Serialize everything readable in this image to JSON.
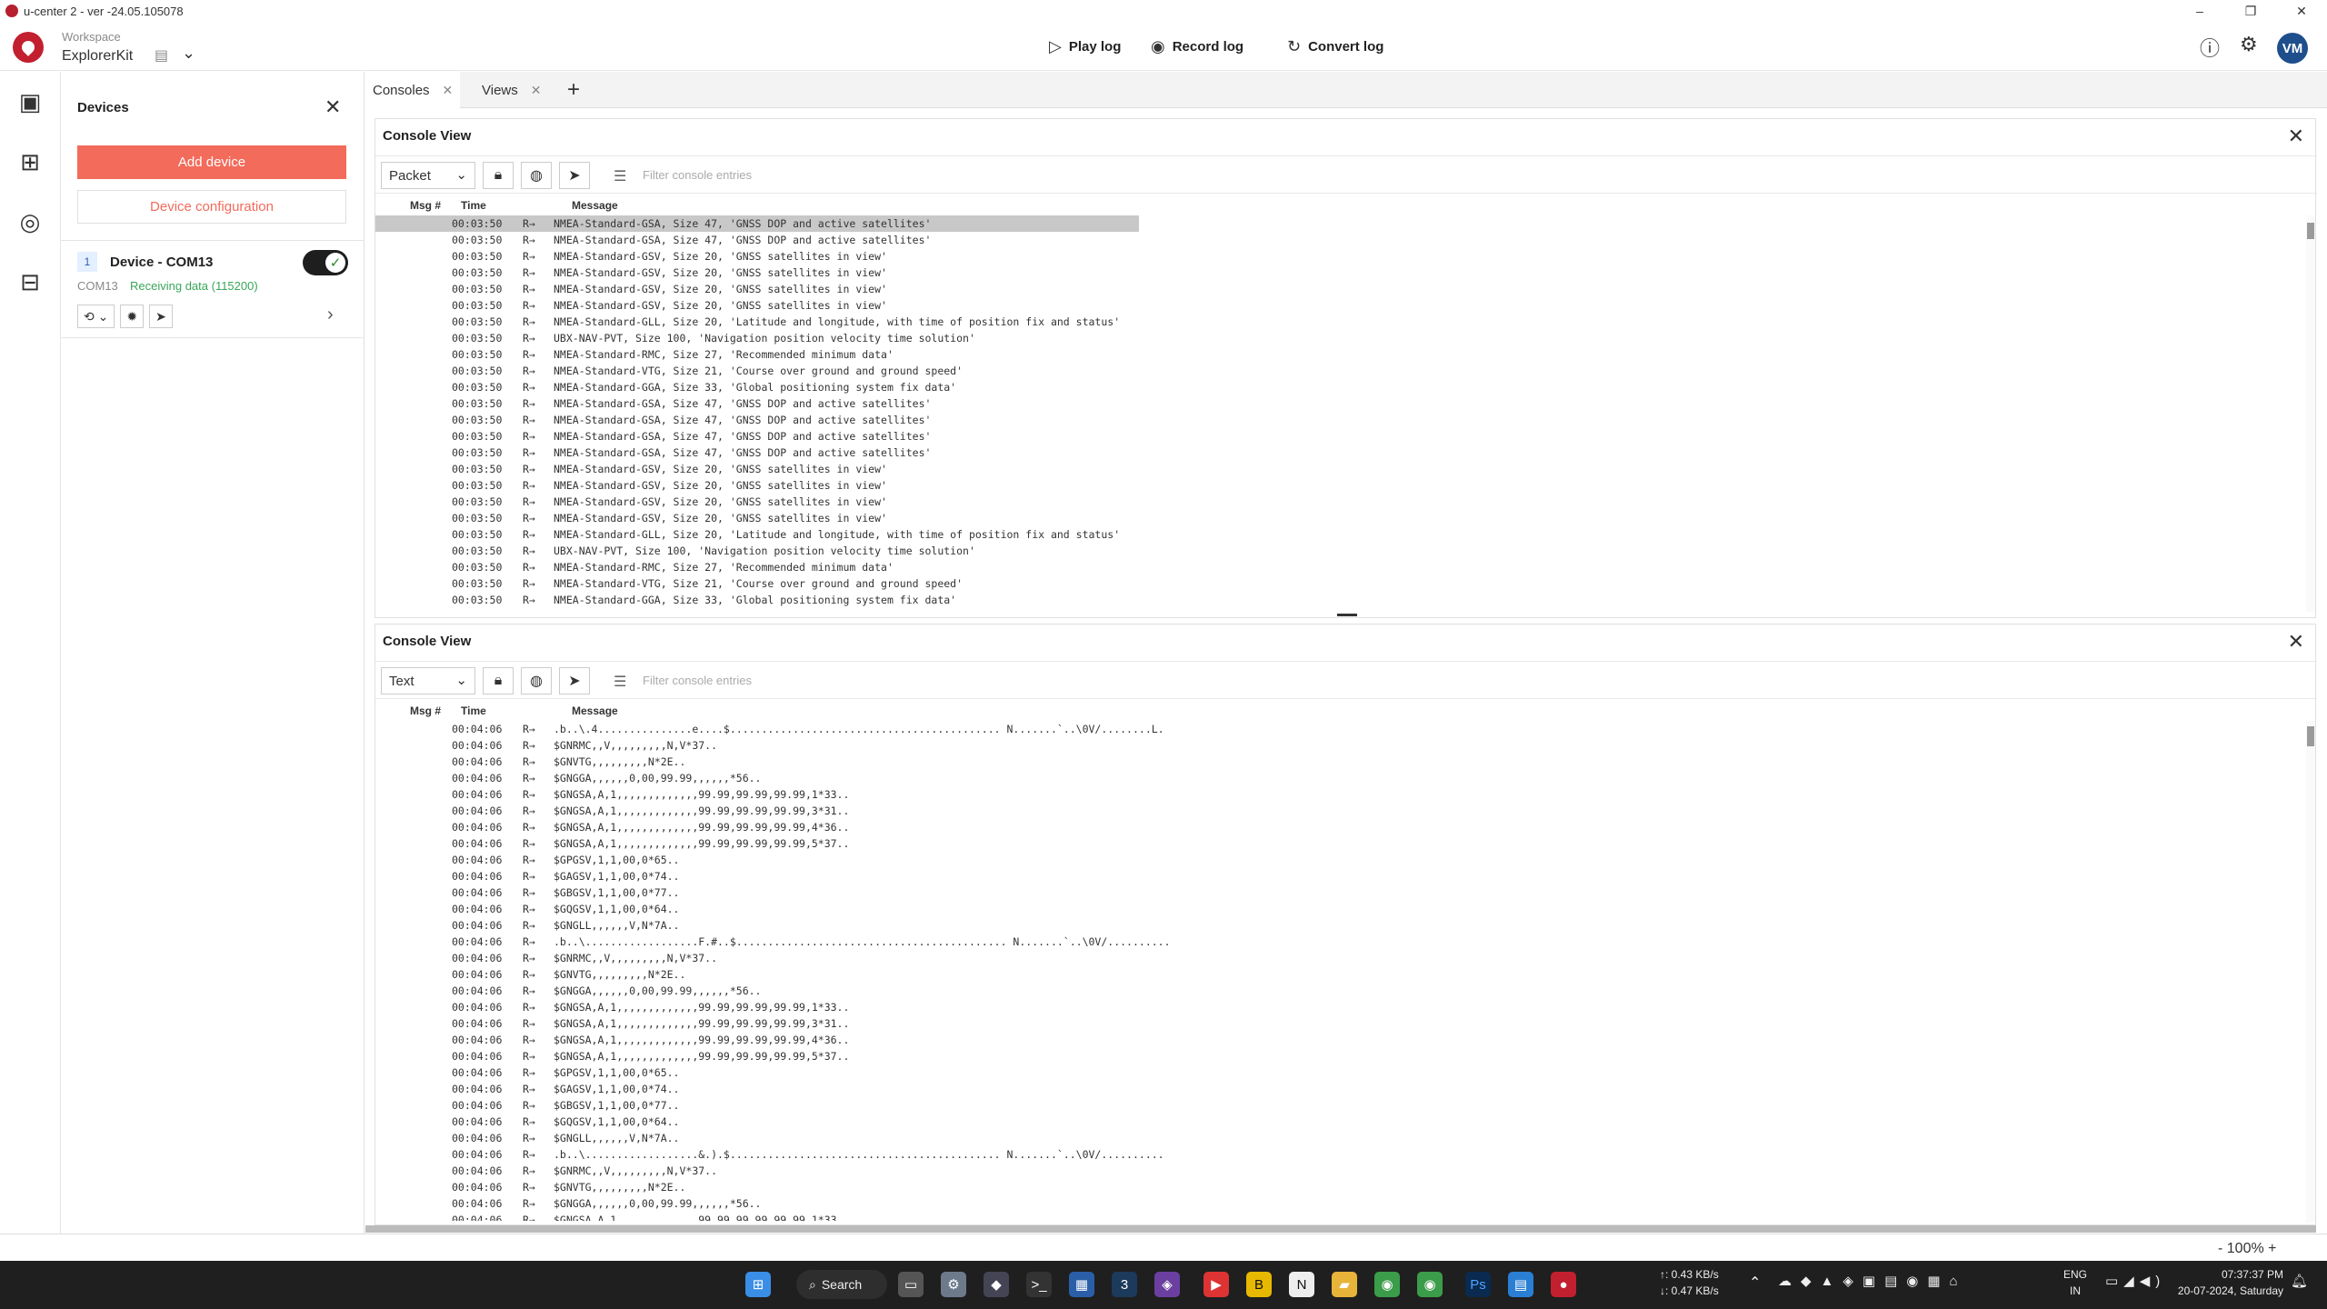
{
  "window": {
    "title": "u-center 2 - ver -24.05.105078",
    "controls": [
      "–",
      "❐",
      "✕"
    ]
  },
  "header": {
    "workspace_label": "Workspace",
    "workspace_name": "ExplorerKit",
    "play_log": "Play log",
    "record_log": "Record log",
    "convert_log": "Convert log",
    "user_initials": "VM"
  },
  "devices": {
    "title": "Devices",
    "add_device": "Add device",
    "device_configuration": "Device configuration",
    "item": {
      "index": "1",
      "name": "Device - COM13",
      "port": "COM13",
      "status": "Receiving data (115200)",
      "enabled": true
    }
  },
  "tabs": [
    {
      "label": "Consoles",
      "active": true
    },
    {
      "label": "Views",
      "active": false
    }
  ],
  "consoles": [
    {
      "title": "Console View",
      "mode": "Packet",
      "filter_placeholder": "Filter console entries",
      "columns": [
        "Msg #",
        "Time",
        "Message"
      ],
      "rows": [
        {
          "time": "00:03:50",
          "dir": "R→",
          "msg": "NMEA-Standard-GSA, Size 47, 'GNSS DOP and active satellites'",
          "selected": true
        },
        {
          "time": "00:03:50",
          "dir": "R→",
          "msg": "NMEA-Standard-GSA, Size 47, 'GNSS DOP and active satellites'"
        },
        {
          "time": "00:03:50",
          "dir": "R→",
          "msg": "NMEA-Standard-GSV, Size 20, 'GNSS satellites in view'"
        },
        {
          "time": "00:03:50",
          "dir": "R→",
          "msg": "NMEA-Standard-GSV, Size 20, 'GNSS satellites in view'"
        },
        {
          "time": "00:03:50",
          "dir": "R→",
          "msg": "NMEA-Standard-GSV, Size 20, 'GNSS satellites in view'"
        },
        {
          "time": "00:03:50",
          "dir": "R→",
          "msg": "NMEA-Standard-GSV, Size 20, 'GNSS satellites in view'"
        },
        {
          "time": "00:03:50",
          "dir": "R→",
          "msg": "NMEA-Standard-GLL, Size 20, 'Latitude and longitude, with time of position fix and status'"
        },
        {
          "time": "00:03:50",
          "dir": "R→",
          "msg": "UBX-NAV-PVT, Size 100, 'Navigation position velocity time solution'"
        },
        {
          "time": "00:03:50",
          "dir": "R→",
          "msg": "NMEA-Standard-RMC, Size 27, 'Recommended minimum data'"
        },
        {
          "time": "00:03:50",
          "dir": "R→",
          "msg": "NMEA-Standard-VTG, Size 21, 'Course over ground and ground speed'"
        },
        {
          "time": "00:03:50",
          "dir": "R→",
          "msg": "NMEA-Standard-GGA, Size 33, 'Global positioning system fix data'"
        },
        {
          "time": "00:03:50",
          "dir": "R→",
          "msg": "NMEA-Standard-GSA, Size 47, 'GNSS DOP and active satellites'"
        },
        {
          "time": "00:03:50",
          "dir": "R→",
          "msg": "NMEA-Standard-GSA, Size 47, 'GNSS DOP and active satellites'"
        },
        {
          "time": "00:03:50",
          "dir": "R→",
          "msg": "NMEA-Standard-GSA, Size 47, 'GNSS DOP and active satellites'"
        },
        {
          "time": "00:03:50",
          "dir": "R→",
          "msg": "NMEA-Standard-GSA, Size 47, 'GNSS DOP and active satellites'"
        },
        {
          "time": "00:03:50",
          "dir": "R→",
          "msg": "NMEA-Standard-GSV, Size 20, 'GNSS satellites in view'"
        },
        {
          "time": "00:03:50",
          "dir": "R→",
          "msg": "NMEA-Standard-GSV, Size 20, 'GNSS satellites in view'"
        },
        {
          "time": "00:03:50",
          "dir": "R→",
          "msg": "NMEA-Standard-GSV, Size 20, 'GNSS satellites in view'"
        },
        {
          "time": "00:03:50",
          "dir": "R→",
          "msg": "NMEA-Standard-GSV, Size 20, 'GNSS satellites in view'"
        },
        {
          "time": "00:03:50",
          "dir": "R→",
          "msg": "NMEA-Standard-GLL, Size 20, 'Latitude and longitude, with time of position fix and status'"
        },
        {
          "time": "00:03:50",
          "dir": "R→",
          "msg": "UBX-NAV-PVT, Size 100, 'Navigation position velocity time solution'"
        },
        {
          "time": "00:03:50",
          "dir": "R→",
          "msg": "NMEA-Standard-RMC, Size 27, 'Recommended minimum data'"
        },
        {
          "time": "00:03:50",
          "dir": "R→",
          "msg": "NMEA-Standard-VTG, Size 21, 'Course over ground and ground speed'"
        },
        {
          "time": "00:03:50",
          "dir": "R→",
          "msg": "NMEA-Standard-GGA, Size 33, 'Global positioning system fix data'"
        }
      ]
    },
    {
      "title": "Console View",
      "mode": "Text",
      "filter_placeholder": "Filter console entries",
      "columns": [
        "Msg #",
        "Time",
        "Message"
      ],
      "rows": [
        {
          "time": "00:04:06",
          "dir": "R→",
          "msg": ".b..\\.4...............e....$........................................... N.......`..\\0V/........L."
        },
        {
          "time": "00:04:06",
          "dir": "R→",
          "msg": "$GNRMC,,V,,,,,,,,,N,V*37.."
        },
        {
          "time": "00:04:06",
          "dir": "R→",
          "msg": "$GNVTG,,,,,,,,,N*2E.."
        },
        {
          "time": "00:04:06",
          "dir": "R→",
          "msg": "$GNGGA,,,,,,0,00,99.99,,,,,,*56.."
        },
        {
          "time": "00:04:06",
          "dir": "R→",
          "msg": "$GNGSA,A,1,,,,,,,,,,,,,99.99,99.99,99.99,1*33.."
        },
        {
          "time": "00:04:06",
          "dir": "R→",
          "msg": "$GNGSA,A,1,,,,,,,,,,,,,99.99,99.99,99.99,3*31.."
        },
        {
          "time": "00:04:06",
          "dir": "R→",
          "msg": "$GNGSA,A,1,,,,,,,,,,,,,99.99,99.99,99.99,4*36.."
        },
        {
          "time": "00:04:06",
          "dir": "R→",
          "msg": "$GNGSA,A,1,,,,,,,,,,,,,99.99,99.99,99.99,5*37.."
        },
        {
          "time": "00:04:06",
          "dir": "R→",
          "msg": "$GPGSV,1,1,00,0*65.."
        },
        {
          "time": "00:04:06",
          "dir": "R→",
          "msg": "$GAGSV,1,1,00,0*74.."
        },
        {
          "time": "00:04:06",
          "dir": "R→",
          "msg": "$GBGSV,1,1,00,0*77.."
        },
        {
          "time": "00:04:06",
          "dir": "R→",
          "msg": "$GQGSV,1,1,00,0*64.."
        },
        {
          "time": "00:04:06",
          "dir": "R→",
          "msg": "$GNGLL,,,,,,V,N*7A.."
        },
        {
          "time": "00:04:06",
          "dir": "R→",
          "msg": ".b..\\..................F.#..$........................................... N.......`..\\0V/.........."
        },
        {
          "time": "00:04:06",
          "dir": "R→",
          "msg": "$GNRMC,,V,,,,,,,,,N,V*37.."
        },
        {
          "time": "00:04:06",
          "dir": "R→",
          "msg": "$GNVTG,,,,,,,,,N*2E.."
        },
        {
          "time": "00:04:06",
          "dir": "R→",
          "msg": "$GNGGA,,,,,,0,00,99.99,,,,,,*56.."
        },
        {
          "time": "00:04:06",
          "dir": "R→",
          "msg": "$GNGSA,A,1,,,,,,,,,,,,,99.99,99.99,99.99,1*33.."
        },
        {
          "time": "00:04:06",
          "dir": "R→",
          "msg": "$GNGSA,A,1,,,,,,,,,,,,,99.99,99.99,99.99,3*31.."
        },
        {
          "time": "00:04:06",
          "dir": "R→",
          "msg": "$GNGSA,A,1,,,,,,,,,,,,,99.99,99.99,99.99,4*36.."
        },
        {
          "time": "00:04:06",
          "dir": "R→",
          "msg": "$GNGSA,A,1,,,,,,,,,,,,,99.99,99.99,99.99,5*37.."
        },
        {
          "time": "00:04:06",
          "dir": "R→",
          "msg": "$GPGSV,1,1,00,0*65.."
        },
        {
          "time": "00:04:06",
          "dir": "R→",
          "msg": "$GAGSV,1,1,00,0*74.."
        },
        {
          "time": "00:04:06",
          "dir": "R→",
          "msg": "$GBGSV,1,1,00,0*77.."
        },
        {
          "time": "00:04:06",
          "dir": "R→",
          "msg": "$GQGSV,1,1,00,0*64.."
        },
        {
          "time": "00:04:06",
          "dir": "R→",
          "msg": "$GNGLL,,,,,,V,N*7A.."
        },
        {
          "time": "00:04:06",
          "dir": "R→",
          "msg": ".b..\\..................&.).$........................................... N.......`..\\0V/.........."
        },
        {
          "time": "00:04:06",
          "dir": "R→",
          "msg": "$GNRMC,,V,,,,,,,,,N,V*37.."
        },
        {
          "time": "00:04:06",
          "dir": "R→",
          "msg": "$GNVTG,,,,,,,,,N*2E.."
        },
        {
          "time": "00:04:06",
          "dir": "R→",
          "msg": "$GNGGA,,,,,,0,00,99.99,,,,,,*56.."
        },
        {
          "time": "00:04:06",
          "dir": "R→",
          "msg": "$GNGSA,A,1,,,,,,,,,,,,,99.99,99.99,99.99,1*33.."
        }
      ]
    }
  ],
  "statusbar": {
    "zoom": "-   100%   +"
  },
  "taskbar": {
    "search_label": "Search",
    "steam_badge": "3",
    "net_up": "↑: 0.43 KB/s",
    "net_down": "↓: 0.47 KB/s",
    "lang": "ENG",
    "region": "IN",
    "time": "07:37:37 PM",
    "date": "20-07-2024, Saturday"
  },
  "colors": {
    "accent": "#f36b5a",
    "brand": "#c21f2f",
    "status_ok": "#3aa65a",
    "taskbar": "#1f1f1f"
  }
}
